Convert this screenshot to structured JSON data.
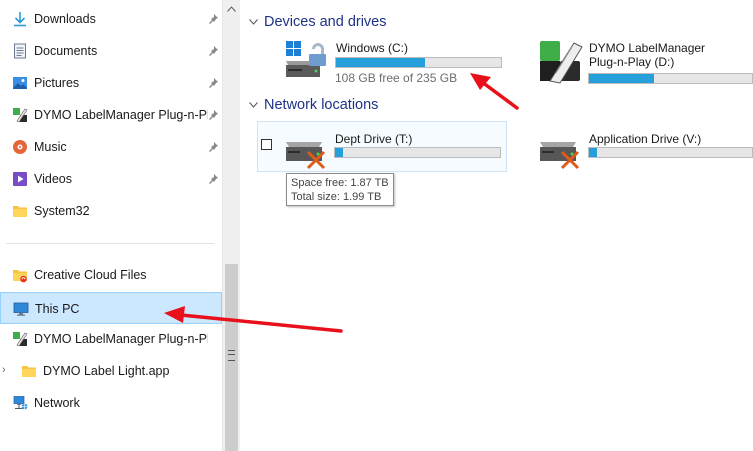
{
  "nav": {
    "quick_access": [
      {
        "label": "Downloads",
        "icon": "download-arrow-icon",
        "pinned": true
      },
      {
        "label": "Documents",
        "icon": "documents-icon",
        "pinned": true
      },
      {
        "label": "Pictures",
        "icon": "pictures-icon",
        "pinned": true
      },
      {
        "label": "DYMO LabelManager Plug-n-Play",
        "icon": "dymo-app-icon",
        "pinned": true
      },
      {
        "label": "Music",
        "icon": "music-icon",
        "pinned": true
      },
      {
        "label": "Videos",
        "icon": "videos-icon",
        "pinned": true
      },
      {
        "label": "System32",
        "icon": "folder-icon",
        "pinned": false
      }
    ],
    "locations": [
      {
        "label": "Creative Cloud Files",
        "icon": "creative-cloud-folder-icon"
      },
      {
        "label": "This PC",
        "icon": "monitor-icon",
        "selected": true
      },
      {
        "label": "DYMO LabelManager Plug-n-Play (D:)",
        "icon": "dymo-app-icon"
      },
      {
        "label": "DYMO Label Light.app",
        "icon": "folder-icon",
        "expandable": true
      },
      {
        "label": "Network",
        "icon": "network-icon"
      }
    ]
  },
  "main": {
    "devices_heading": "Devices and drives",
    "network_heading": "Network locations",
    "drives": [
      {
        "name": "Windows (C:)",
        "free_text": "108 GB free of 235 GB",
        "used_fraction": 0.54,
        "icon": "windows-drive-icon"
      },
      {
        "name_line1": "DYMO LabelManager",
        "name_line2": "Plug-n-Play (D:)",
        "used_fraction": 0.4,
        "icon": "dymo-drive-icon"
      }
    ],
    "network_drives": [
      {
        "name": "Dept Drive (T:)",
        "used_fraction": 0.05,
        "icon": "disconnected-network-drive-icon",
        "selected": true
      },
      {
        "name": "Application Drive (V:)",
        "used_fraction": 0.05,
        "icon": "disconnected-network-drive-icon"
      }
    ],
    "tooltip": {
      "line1": "Space free: 1.87 TB",
      "line2": "Total size: 1.99 TB"
    }
  },
  "colors": {
    "accent": "#26a0da",
    "heading": "#1e3287",
    "selection": "#cce8ff",
    "annotation_arrow": "#e8101a"
  }
}
